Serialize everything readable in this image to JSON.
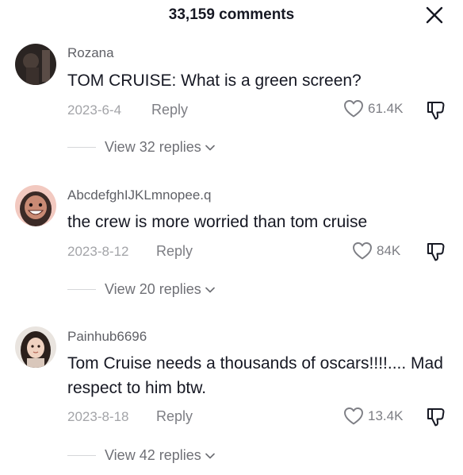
{
  "header": {
    "title": "33,159 comments"
  },
  "comments": [
    {
      "username": "Rozana",
      "text": "TOM CRUISE: What is a green screen?",
      "date": "2023-6-4",
      "reply_label": "Reply",
      "likes": "61.4K",
      "view_replies": "View 32 replies"
    },
    {
      "username": "AbcdefghIJKLmnopee.q",
      "text": "the crew is more worried than tom cruise",
      "date": "2023-8-12",
      "reply_label": "Reply",
      "likes": "84K",
      "view_replies": "View 20 replies"
    },
    {
      "username": "Painhub6696",
      "text": "Tom Cruise needs a thousands of oscars!!!!.... Mad respect to him btw.",
      "date": "2023-8-18",
      "reply_label": "Reply",
      "likes": "13.4K",
      "view_replies": "View 42 replies"
    }
  ],
  "icons": {
    "close": "close-icon",
    "like": "heart-icon",
    "dislike": "thumbs-down-icon",
    "expand": "chevron-down-icon"
  }
}
